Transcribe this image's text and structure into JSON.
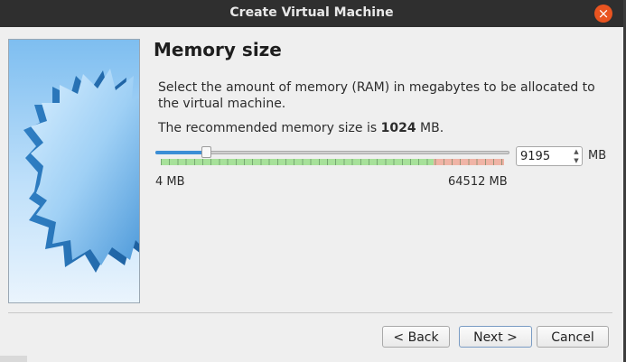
{
  "window": {
    "title": "Create Virtual Machine",
    "close_icon": "close-icon"
  },
  "page": {
    "heading": "Memory size",
    "description": "Select the amount of memory (RAM) in megabytes to be allocated to the virtual machine.",
    "recommended_prefix": "The recommended memory size is ",
    "recommended_value": "1024",
    "recommended_suffix": " MB."
  },
  "memory": {
    "value": "9195",
    "min_label": "4 MB",
    "max_label": "64512 MB",
    "min": 4,
    "max": 64512,
    "current": 9195,
    "unit": "MB",
    "safe_limit_fraction": 0.8,
    "colors": {
      "safe": "#a7e19a",
      "danger": "#f0b4a6",
      "fill": "#3b8ed6"
    }
  },
  "buttons": {
    "back": "< Back",
    "next": "Next >",
    "cancel": "Cancel"
  }
}
